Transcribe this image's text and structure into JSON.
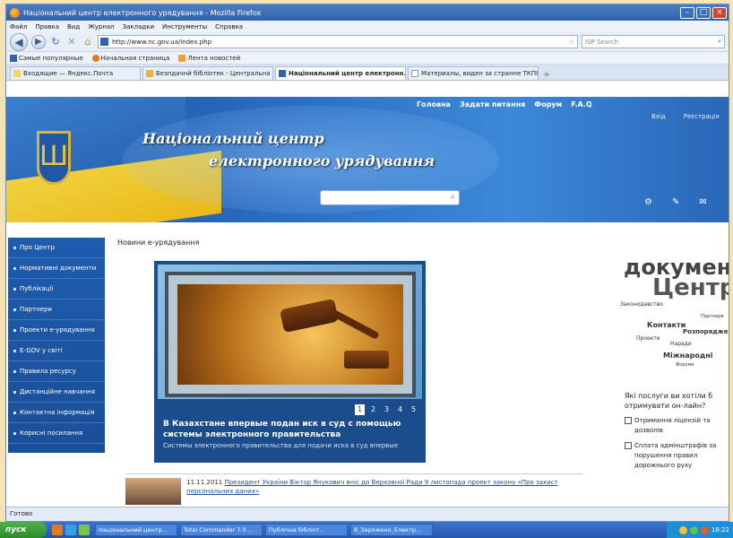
{
  "window": {
    "title": "Національний центр електронного урядування - Mozilla Firefox",
    "controls": [
      "–",
      "□",
      "×"
    ]
  },
  "menu": [
    "Файл",
    "Правка",
    "Вид",
    "Журнал",
    "Закладки",
    "Инструменты",
    "Справка"
  ],
  "navbar": {
    "url": "http://www.nc.gov.ua/index.php",
    "search_placeholder": "ISP Search"
  },
  "bookmarks": [
    "Самые популярные",
    "Начальная страница",
    "Лента новостей"
  ],
  "tabs": [
    {
      "label": "Входящие — Яндекс.Почта",
      "active": false
    },
    {
      "label": "Безпдачнй бібліотек - Центральна ...",
      "active": false
    },
    {
      "label": "Національний центр електронн...",
      "active": true
    },
    {
      "label": "Материалы, виден за странне ТКПІІ",
      "active": false
    }
  ],
  "site": {
    "title_line1": "Національний центр",
    "title_line2": "електронного урядування",
    "topnav": [
      "Головна",
      "Задати питання",
      "Форум",
      "F.A.Q"
    ],
    "auth": [
      "Вхід",
      "Реєстрація"
    ],
    "tools": [
      "⚙",
      "✎",
      "✉"
    ]
  },
  "sidebar": [
    "Про Центр",
    "Нормативні документи",
    "Публікації",
    "Партнери",
    "Проекти е-урядування",
    "E-GOV у світі",
    "Правила ресурсу",
    "Дистанційне навчання",
    "Контактна інформація",
    "Корисні посилання"
  ],
  "news": {
    "heading": "Новини е-урядування",
    "slider_pages": [
      "1",
      "2",
      "3",
      "4",
      "5"
    ],
    "slider_active": "1",
    "headline": "В Казахстане впервые подан иск в суд с помощью системы электронного правительства",
    "subline": "Системы электронного правительства для подачи иска в суд впервые",
    "item_date": "11.11.2011",
    "item_text": "Президент України Віктор Янукович вніс до Верховної Ради 9 листопада проект закону «Про захист персональних даних»"
  },
  "tagcloud": [
    "докумен",
    "Центр",
    "Законодавство",
    "Контакти",
    "Розпорядження",
    "Проекти",
    "Наради",
    "Міжнародні",
    "Партнери",
    "Форуми"
  ],
  "poll": {
    "question": "Які послуги ви хотіли б отримувати он-лайн?",
    "options": [
      "Отримання ліцензій та дозволів",
      "Сплата адмінштрафів за порушення правил дорожнього руху"
    ]
  },
  "status": "Готово",
  "taskbar": {
    "start": "пуск",
    "tasks": [
      "Національний центр...",
      "Total Commander 7.0 ...",
      "Публічна бібліот...",
      "8_Заряжено_Електр..."
    ],
    "clock": "18:22"
  }
}
